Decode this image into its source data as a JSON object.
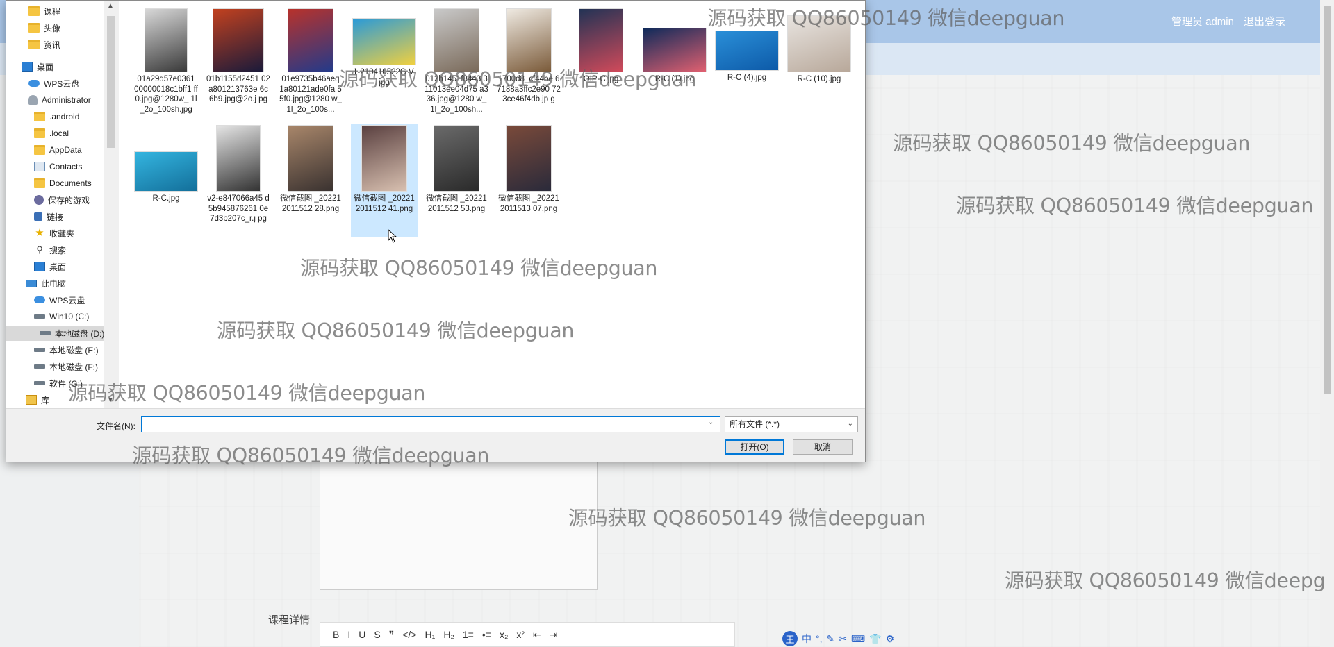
{
  "app": {
    "header_user": "管理员 admin",
    "logout_label": "退出登录",
    "detail_label": "课程详情",
    "editor_toolbar": [
      "B",
      "I",
      "U",
      "S",
      "❞",
      "</>",
      "H₁",
      "H₂",
      "1≡",
      "•≡",
      "x₂",
      "x²",
      "⇤",
      "⇥"
    ],
    "ime": [
      "王",
      "中",
      "°,",
      "✎",
      "✂",
      "⌨",
      "👕",
      "⚙"
    ]
  },
  "dialog": {
    "nav_items": [
      {
        "label": "课程",
        "icon": "folder-icon"
      },
      {
        "label": "头像",
        "icon": "folder-icon"
      },
      {
        "label": "资讯",
        "icon": "folder-icon"
      },
      {
        "label": "桌面",
        "icon": "desktop-icon"
      },
      {
        "label": "WPS云盘",
        "icon": "cloud-icon"
      },
      {
        "label": "Administrator",
        "icon": "user-icon"
      },
      {
        "label": ".android",
        "icon": "folder-icon"
      },
      {
        "label": ".local",
        "icon": "folder-icon"
      },
      {
        "label": "AppData",
        "icon": "folder-icon"
      },
      {
        "label": "Contacts",
        "icon": "contacts-icon"
      },
      {
        "label": "Documents",
        "icon": "folder-icon"
      },
      {
        "label": "保存的游戏",
        "icon": "game-icon"
      },
      {
        "label": "链接",
        "icon": "link-icon"
      },
      {
        "label": "收藏夹",
        "icon": "star-icon"
      },
      {
        "label": "搜索",
        "icon": "search-icon"
      },
      {
        "label": "桌面",
        "icon": "desktop-icon"
      },
      {
        "label": "此电脑",
        "icon": "pc-icon"
      },
      {
        "label": "WPS云盘",
        "icon": "cloud-icon"
      },
      {
        "label": "Win10 (C:)",
        "icon": "drive-icon"
      },
      {
        "label": "本地磁盘 (D:)",
        "icon": "drive-icon"
      },
      {
        "label": "本地磁盘 (E:)",
        "icon": "drive-icon"
      },
      {
        "label": "本地磁盘 (F:)",
        "icon": "drive-icon"
      },
      {
        "label": "软件 (G:)",
        "icon": "drive-icon"
      },
      {
        "label": "库",
        "icon": "library-icon"
      }
    ],
    "selected_nav": "本地磁盘 (D:)",
    "files": [
      {
        "name": "01a29d57e0361 00000018c1bff1 ff0.jpg@1280w_ 1l_2o_100sh.jpg",
        "colors": [
          "#d8d8d8",
          "#3a3a3a"
        ]
      },
      {
        "name": "01b1155d2451 02a801213763e 6c6b9.jpg@2o.j pg",
        "colors": [
          "#c2411f",
          "#1a1a3a"
        ]
      },
      {
        "name": "01e9735b46aeq 1a80121ade0fa 55f0.jpg@1280 w_1l_2o_100s...",
        "colors": [
          "#b8322b",
          "#233a8a"
        ]
      },
      {
        "name": "1-210410522G V.jpg",
        "colors": [
          "#2a9ad8",
          "#f0d040"
        ]
      },
      {
        "name": "012b1451f8443 311013ee04d75 a336.jpg@1280 w_1l_2o_100sh...",
        "colors": [
          "#c9c9c9",
          "#7a6a5a"
        ]
      },
      {
        "name": "1700d8_cf44be 67188a3ffc2e90 723ce46f4db.jp g",
        "colors": [
          "#efeae2",
          "#7b5b3a"
        ]
      },
      {
        "name": "OIP-C.jpg",
        "colors": [
          "#223355",
          "#d04a5a"
        ]
      },
      {
        "name": "R-C (1).jpg",
        "colors": [
          "#0f2a5a",
          "#e06070"
        ]
      },
      {
        "name": "R-C (4).jpg",
        "colors": [
          "#2a8fd8",
          "#0d5aa8"
        ]
      },
      {
        "name": "R-C (10).jpg",
        "colors": [
          "#e8e4e0",
          "#b8a89a"
        ]
      },
      {
        "name": "R-C.jpg",
        "colors": [
          "#34b5e0",
          "#136f9a"
        ]
      },
      {
        "name": "v2-e847066a45 d5b945876261 0e7d3b207c_r.j pg",
        "colors": [
          "#e5e5e5",
          "#333333"
        ]
      },
      {
        "name": "微信截图 _202212011512 28.png",
        "colors": [
          "#a8866a",
          "#3a3230"
        ]
      },
      {
        "name": "微信截图 _202212011512 41.png",
        "colors": [
          "#5a4040",
          "#d8c0b0"
        ]
      },
      {
        "name": "微信截图 _202212011512 53.png",
        "colors": [
          "#6a6a6a",
          "#2a2a2a"
        ]
      },
      {
        "name": "微信截图 _202212011513 07.png",
        "colors": [
          "#7a4a3a",
          "#2a2a3a"
        ]
      }
    ],
    "selected_file": "微信截图 _202212011512 41.png",
    "filename_label": "文件名(N):",
    "filename_value": "",
    "filter_value": "所有文件 (*.*)",
    "open_label": "打开(O)",
    "cancel_label": "取消"
  },
  "watermarks": [
    "源码获取 QQ86050149 微信deepguan",
    "源码获取 QQ86050149 微信deepguan",
    "源码获取 QQ86050149 微信deepguan",
    "源码获取 QQ86050149 微信deepguan",
    "源码获取 QQ86050149 微信deepguan",
    "源码获取 QQ86050149 微信deepguan",
    "源码获取 QQ86050149 微信deepguan",
    "源码获取 QQ86050149 微信deepguan",
    "源码获取 QQ86050149 微信deepguan",
    "源码获取 QQ86050149 微信deepg"
  ]
}
